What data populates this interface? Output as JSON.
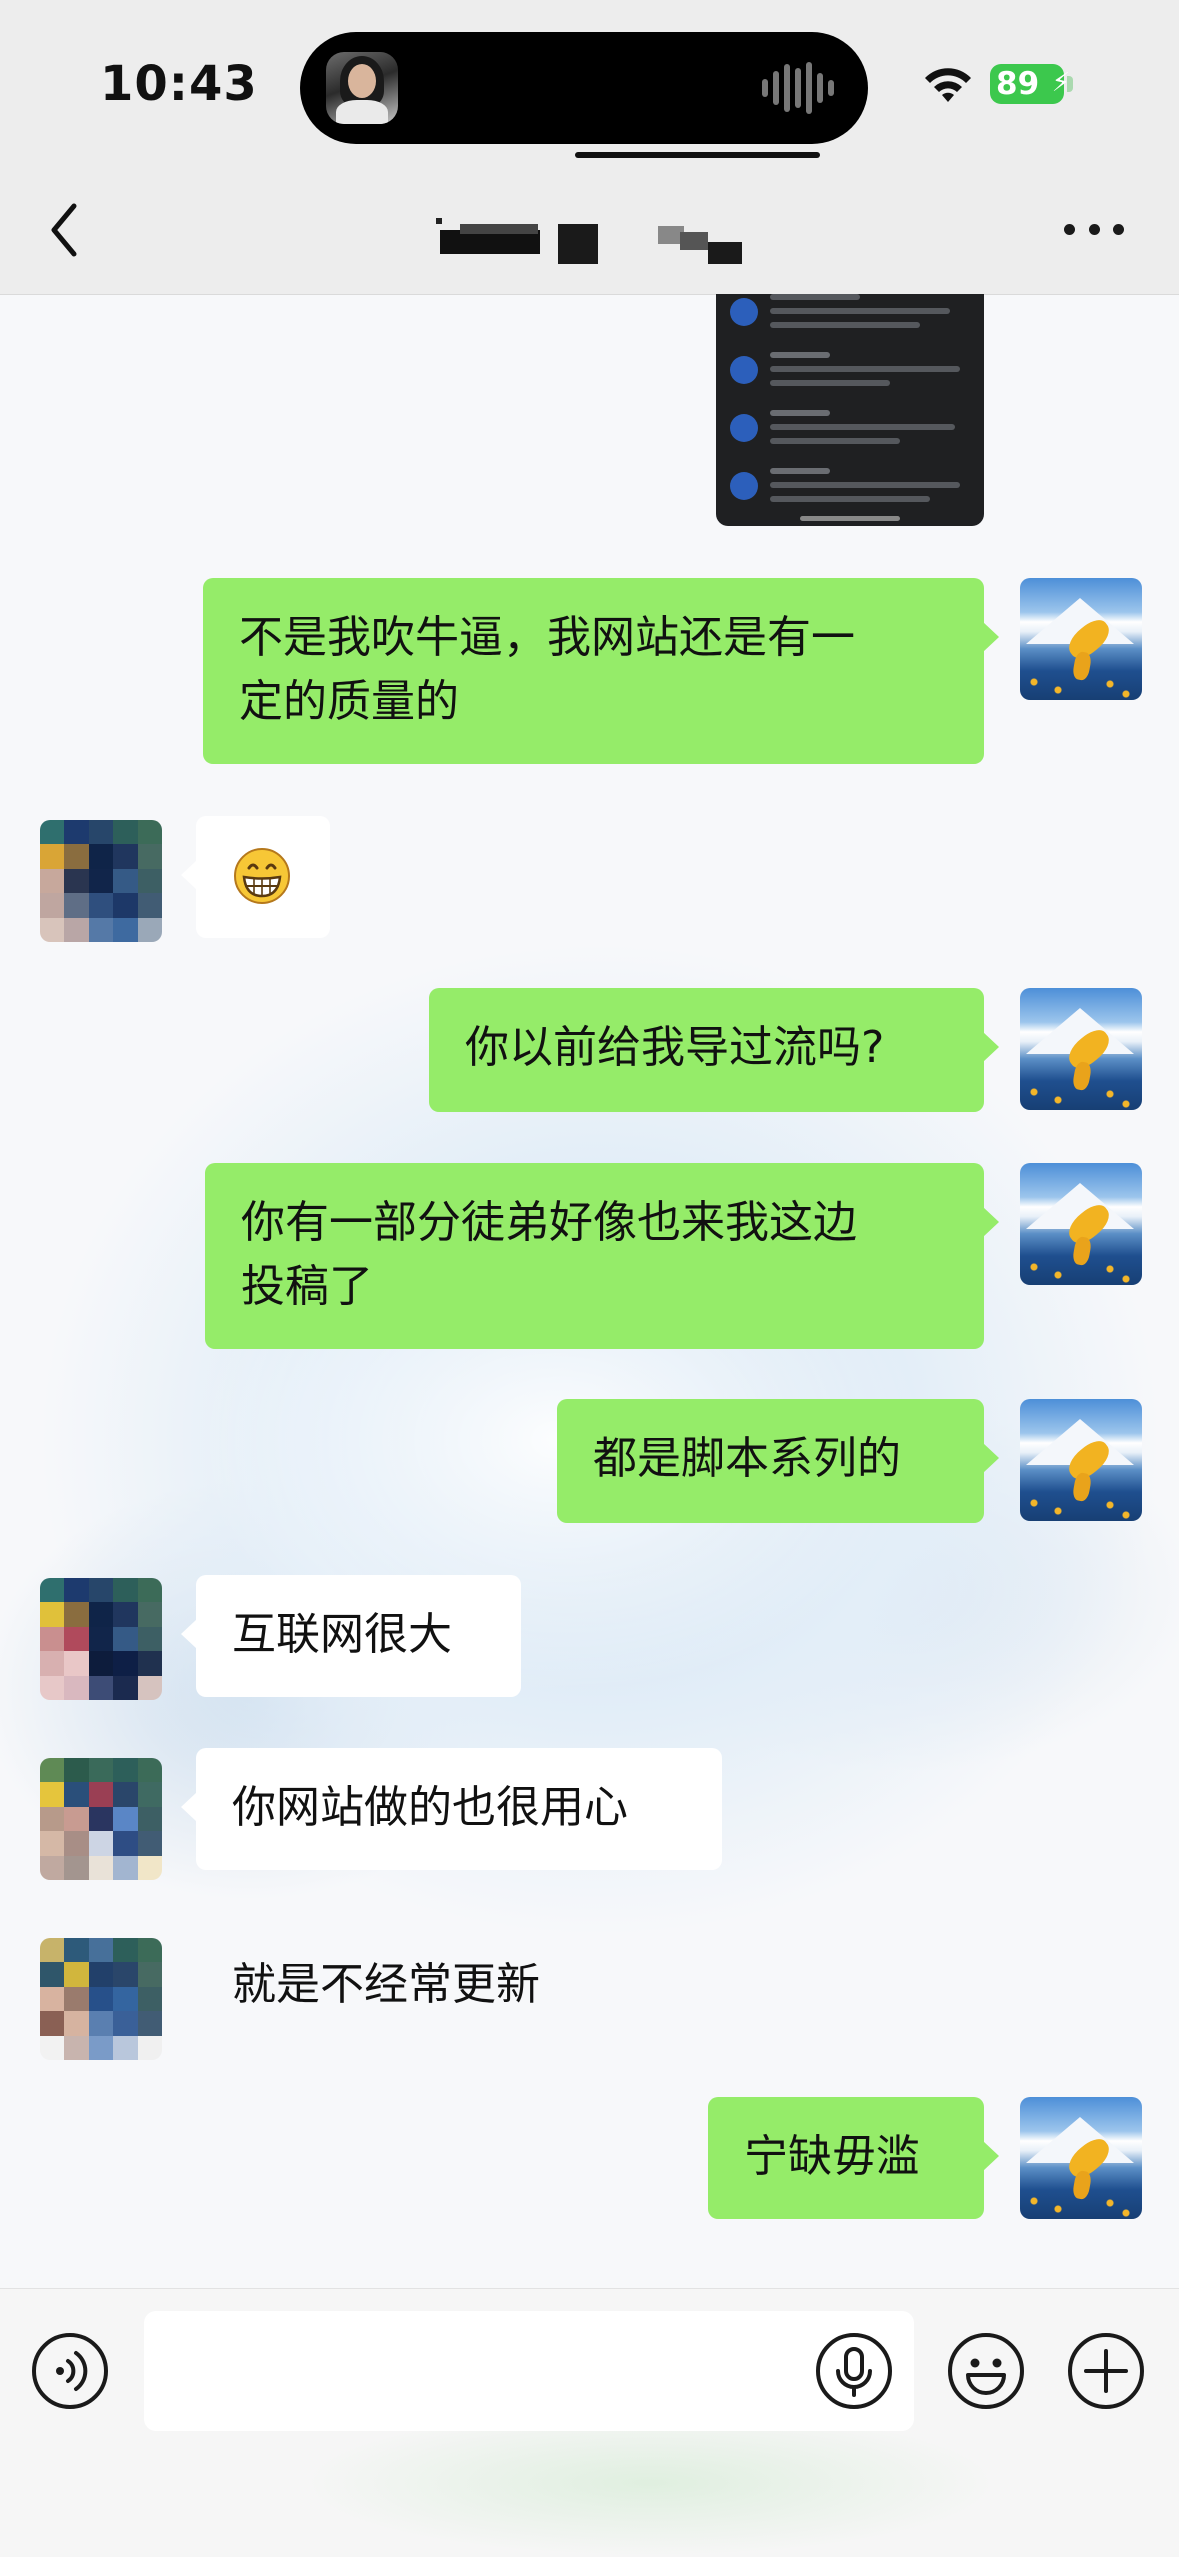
{
  "status_bar": {
    "time": "10:43",
    "battery_percent": "89",
    "icons": [
      "wifi-icon",
      "battery-charging-icon"
    ]
  },
  "nav": {
    "back_icon": "chevron-left-icon",
    "title_redacted": true,
    "more_icon": "more-dots-icon"
  },
  "messages": [
    {
      "id": 1,
      "sender": "self",
      "text": "不是我吹牛逼，我网站还是有一定的质量的"
    },
    {
      "id": 2,
      "sender": "other",
      "type": "emoji",
      "emoji": "grinning-face-icon"
    },
    {
      "id": 3,
      "sender": "self",
      "text": "你以前给我导过流吗?"
    },
    {
      "id": 4,
      "sender": "self",
      "text": "你有一部分徒弟好像也来我这边投稿了"
    },
    {
      "id": 5,
      "sender": "self",
      "text": "都是脚本系列的"
    },
    {
      "id": 6,
      "sender": "other",
      "text": "互联网很大"
    },
    {
      "id": 7,
      "sender": "other",
      "text": "你网站做的也很用心"
    },
    {
      "id": 8,
      "sender": "other",
      "text": "就是不经常更新"
    },
    {
      "id": 9,
      "sender": "self",
      "text": "宁缺毋滥"
    }
  ],
  "message_lines": {
    "m1_line1": "不是我吹牛逼，我网站还是有一",
    "m1_line2": "定的质量的",
    "m4_line1": "你有一部分徒弟好像也来我这边",
    "m4_line2": "投稿了"
  },
  "input_bar": {
    "message_value": "",
    "icons": [
      "voice-mode-icon",
      "microphone-icon",
      "emoji-icon",
      "plus-icon"
    ]
  },
  "colors": {
    "self_bubble": "#95ec69",
    "other_bubble": "#ffffff",
    "chrome_bg": "#ededed",
    "battery_green": "#3cc84d"
  }
}
